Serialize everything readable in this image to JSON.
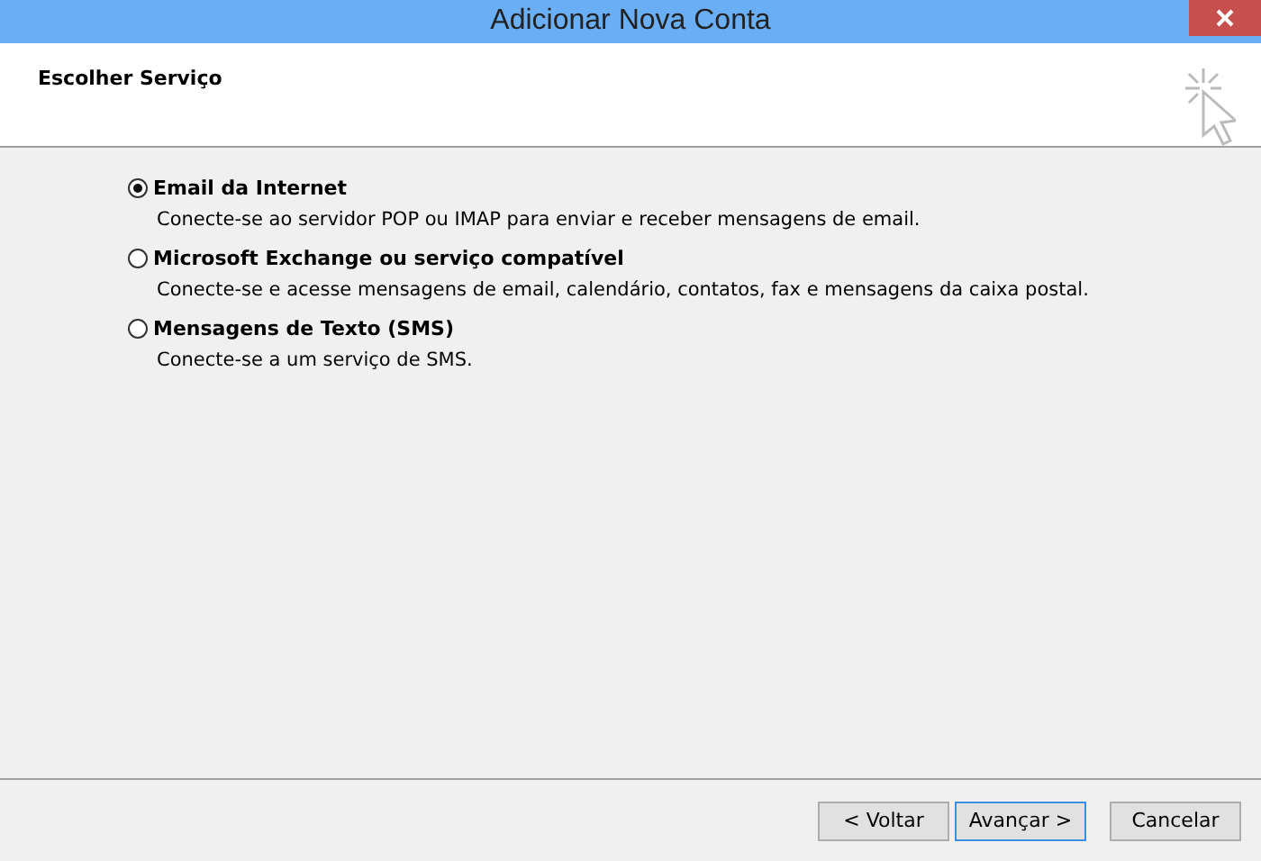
{
  "window": {
    "title": "Adicionar Nova Conta"
  },
  "header": {
    "title": "Escolher Serviço"
  },
  "options": [
    {
      "label": "Email da Internet",
      "description": "Conecte-se ao servidor POP ou IMAP para enviar e receber mensagens de email.",
      "selected": true
    },
    {
      "label": "Microsoft Exchange ou serviço compatível",
      "description": "Conecte-se e acesse mensagens de email, calendário, contatos, fax e mensagens da caixa postal.",
      "selected": false
    },
    {
      "label": "Mensagens de Texto (SMS)",
      "description": "Conecte-se a um serviço de SMS.",
      "selected": false
    }
  ],
  "buttons": [
    {
      "label": "< Voltar",
      "focused": false
    },
    {
      "label": "Avançar >",
      "focused": true
    },
    {
      "label": "Cancelar",
      "focused": false
    }
  ]
}
